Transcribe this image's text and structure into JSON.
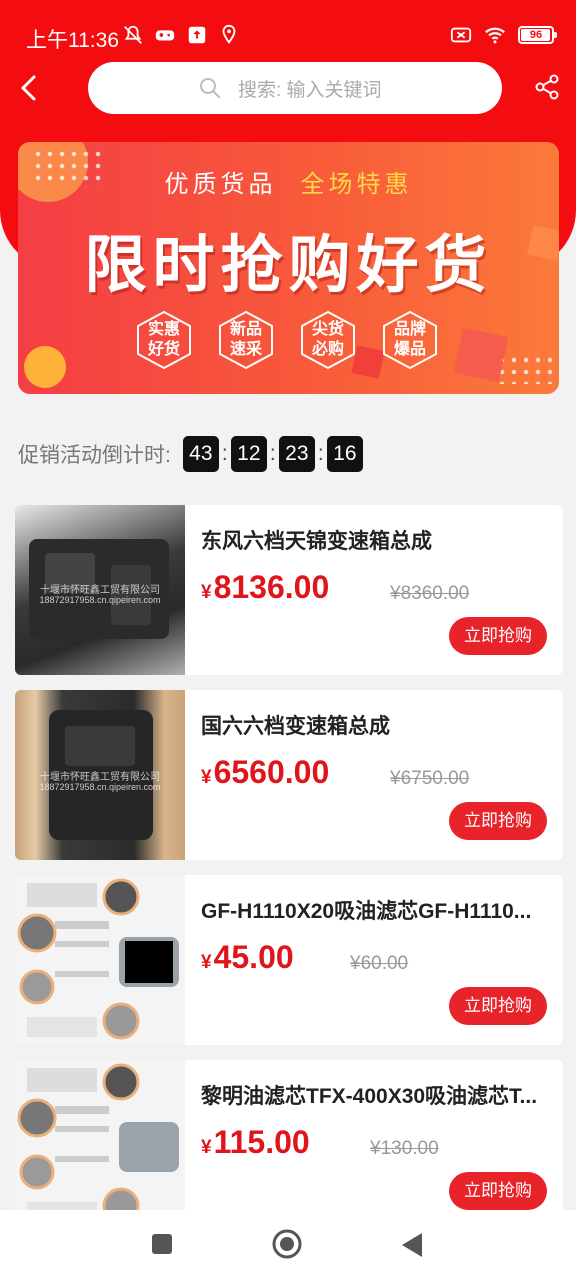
{
  "status_bar": {
    "time": "上午11:36",
    "battery": "96",
    "battery_level": 0.96
  },
  "search": {
    "placeholder": "搜索: 输入关键词"
  },
  "banner": {
    "subtitle_left": "优质货品",
    "subtitle_right": "全场特惠",
    "title": "限时抢购好货",
    "badges": [
      {
        "line1": "实惠",
        "line2": "好货"
      },
      {
        "line1": "新品",
        "line2": "速采"
      },
      {
        "line1": "尖货",
        "line2": "必购"
      },
      {
        "line1": "品牌",
        "line2": "爆品"
      }
    ]
  },
  "countdown": {
    "label": "促销活动倒计时:",
    "hours": "43",
    "minutes": "12",
    "seconds": "23",
    "ms": "16",
    "separator": ":"
  },
  "products": [
    {
      "name": "东风六档天锦变速箱总成",
      "currency": "¥",
      "price": "8136.00",
      "old_price": "¥8360.00",
      "button": "立即抢购",
      "watermark1": "十堰市怀旺鑫工贸有限公司",
      "watermark2": "18872917958.cn.qipeiren.com"
    },
    {
      "name": "国六六档变速箱总成",
      "currency": "¥",
      "price": "6560.00",
      "old_price": "¥6750.00",
      "button": "立即抢购",
      "watermark1": "十堰市怀旺鑫工贸有限公司",
      "watermark2": "18872917958.cn.qipeiren.com"
    },
    {
      "name": "GF-H1110X20吸油滤芯GF-H1110...",
      "currency": "¥",
      "price": "45.00",
      "old_price": "¥60.00",
      "button": "立即抢购"
    },
    {
      "name": "黎明油滤芯TFX-400X30吸油滤芯T...",
      "currency": "¥",
      "price": "115.00",
      "old_price": "¥130.00",
      "button": "立即抢购"
    }
  ],
  "colors": {
    "brand_red": "#f40d10",
    "price_red": "#e0141b",
    "button_red": "#e8232a"
  }
}
